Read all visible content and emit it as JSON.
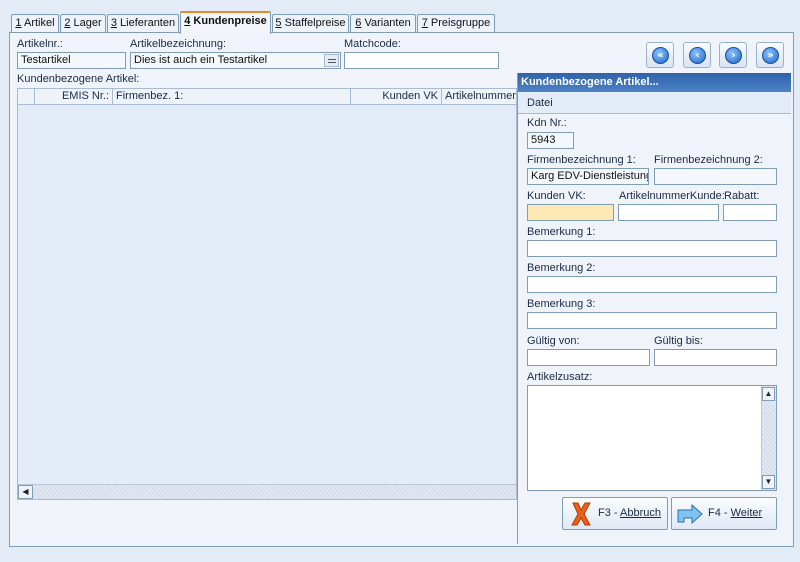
{
  "tabs": [
    {
      "num": "1",
      "label": " Artikel"
    },
    {
      "num": "2",
      "label": " Lager"
    },
    {
      "num": "3",
      "label": " Lieferanten"
    },
    {
      "num": "4",
      "label": " Kundenpreise"
    },
    {
      "num": "5",
      "label": " Staffelpreise"
    },
    {
      "num": "6",
      "label": " Varianten"
    },
    {
      "num": "7",
      "label": " Preisgruppe"
    }
  ],
  "header": {
    "artikelnr_label": "Artikelnr.:",
    "artikelnr_value": "Testartikel",
    "bezeichnung_label": "Artikelbezeichnung:",
    "bezeichnung_value": "Dies ist auch ein Testartikel",
    "matchcode_label": "Matchcode:",
    "matchcode_value": ""
  },
  "nav_icons": [
    "first-icon",
    "previous-icon",
    "next-icon",
    "last-icon"
  ],
  "grid": {
    "title": "Kundenbezogene Artikel:",
    "columns": [
      "EMIS Nr.:",
      "Firmenbez. 1:",
      "Kunden VK",
      "Artikelnummer Kunde"
    ]
  },
  "form": {
    "title": "Kundenbezogene Artikel...",
    "menu_datei": "Datei",
    "kdn_label": "Kdn Nr.:",
    "kdn_value": "5943",
    "firma1_label": "Firmenbezeichnung 1:",
    "firma1_value": "Karg EDV-Dienstleistungen",
    "firma2_label": "Firmenbezeichnung 2:",
    "firma2_value": "",
    "vk_label": "Kunden VK:",
    "vk_value": "",
    "artnr_kunde_label": "ArtikelnummerKunde:",
    "artnr_kunde_value": "",
    "rabatt_label": "Rabatt:",
    "rabatt_value": "",
    "bem1_label": "Bemerkung 1:",
    "bem2_label": "Bemerkung 2:",
    "bem3_label": "Bemerkung 3:",
    "gueltig_von_label": "Gültig von:",
    "gueltig_bis_label": "Gültig bis:",
    "zusatz_label": "Artikelzusatz:",
    "cancel_prefix": "F3 - ",
    "cancel_label": "Abbruch",
    "next_prefix": "F4 - ",
    "next_label": "Weiter"
  },
  "colors": {
    "accent": "#e68b2c",
    "title_bar": "#2f62a8",
    "highlight_field": "#fde9b3"
  }
}
